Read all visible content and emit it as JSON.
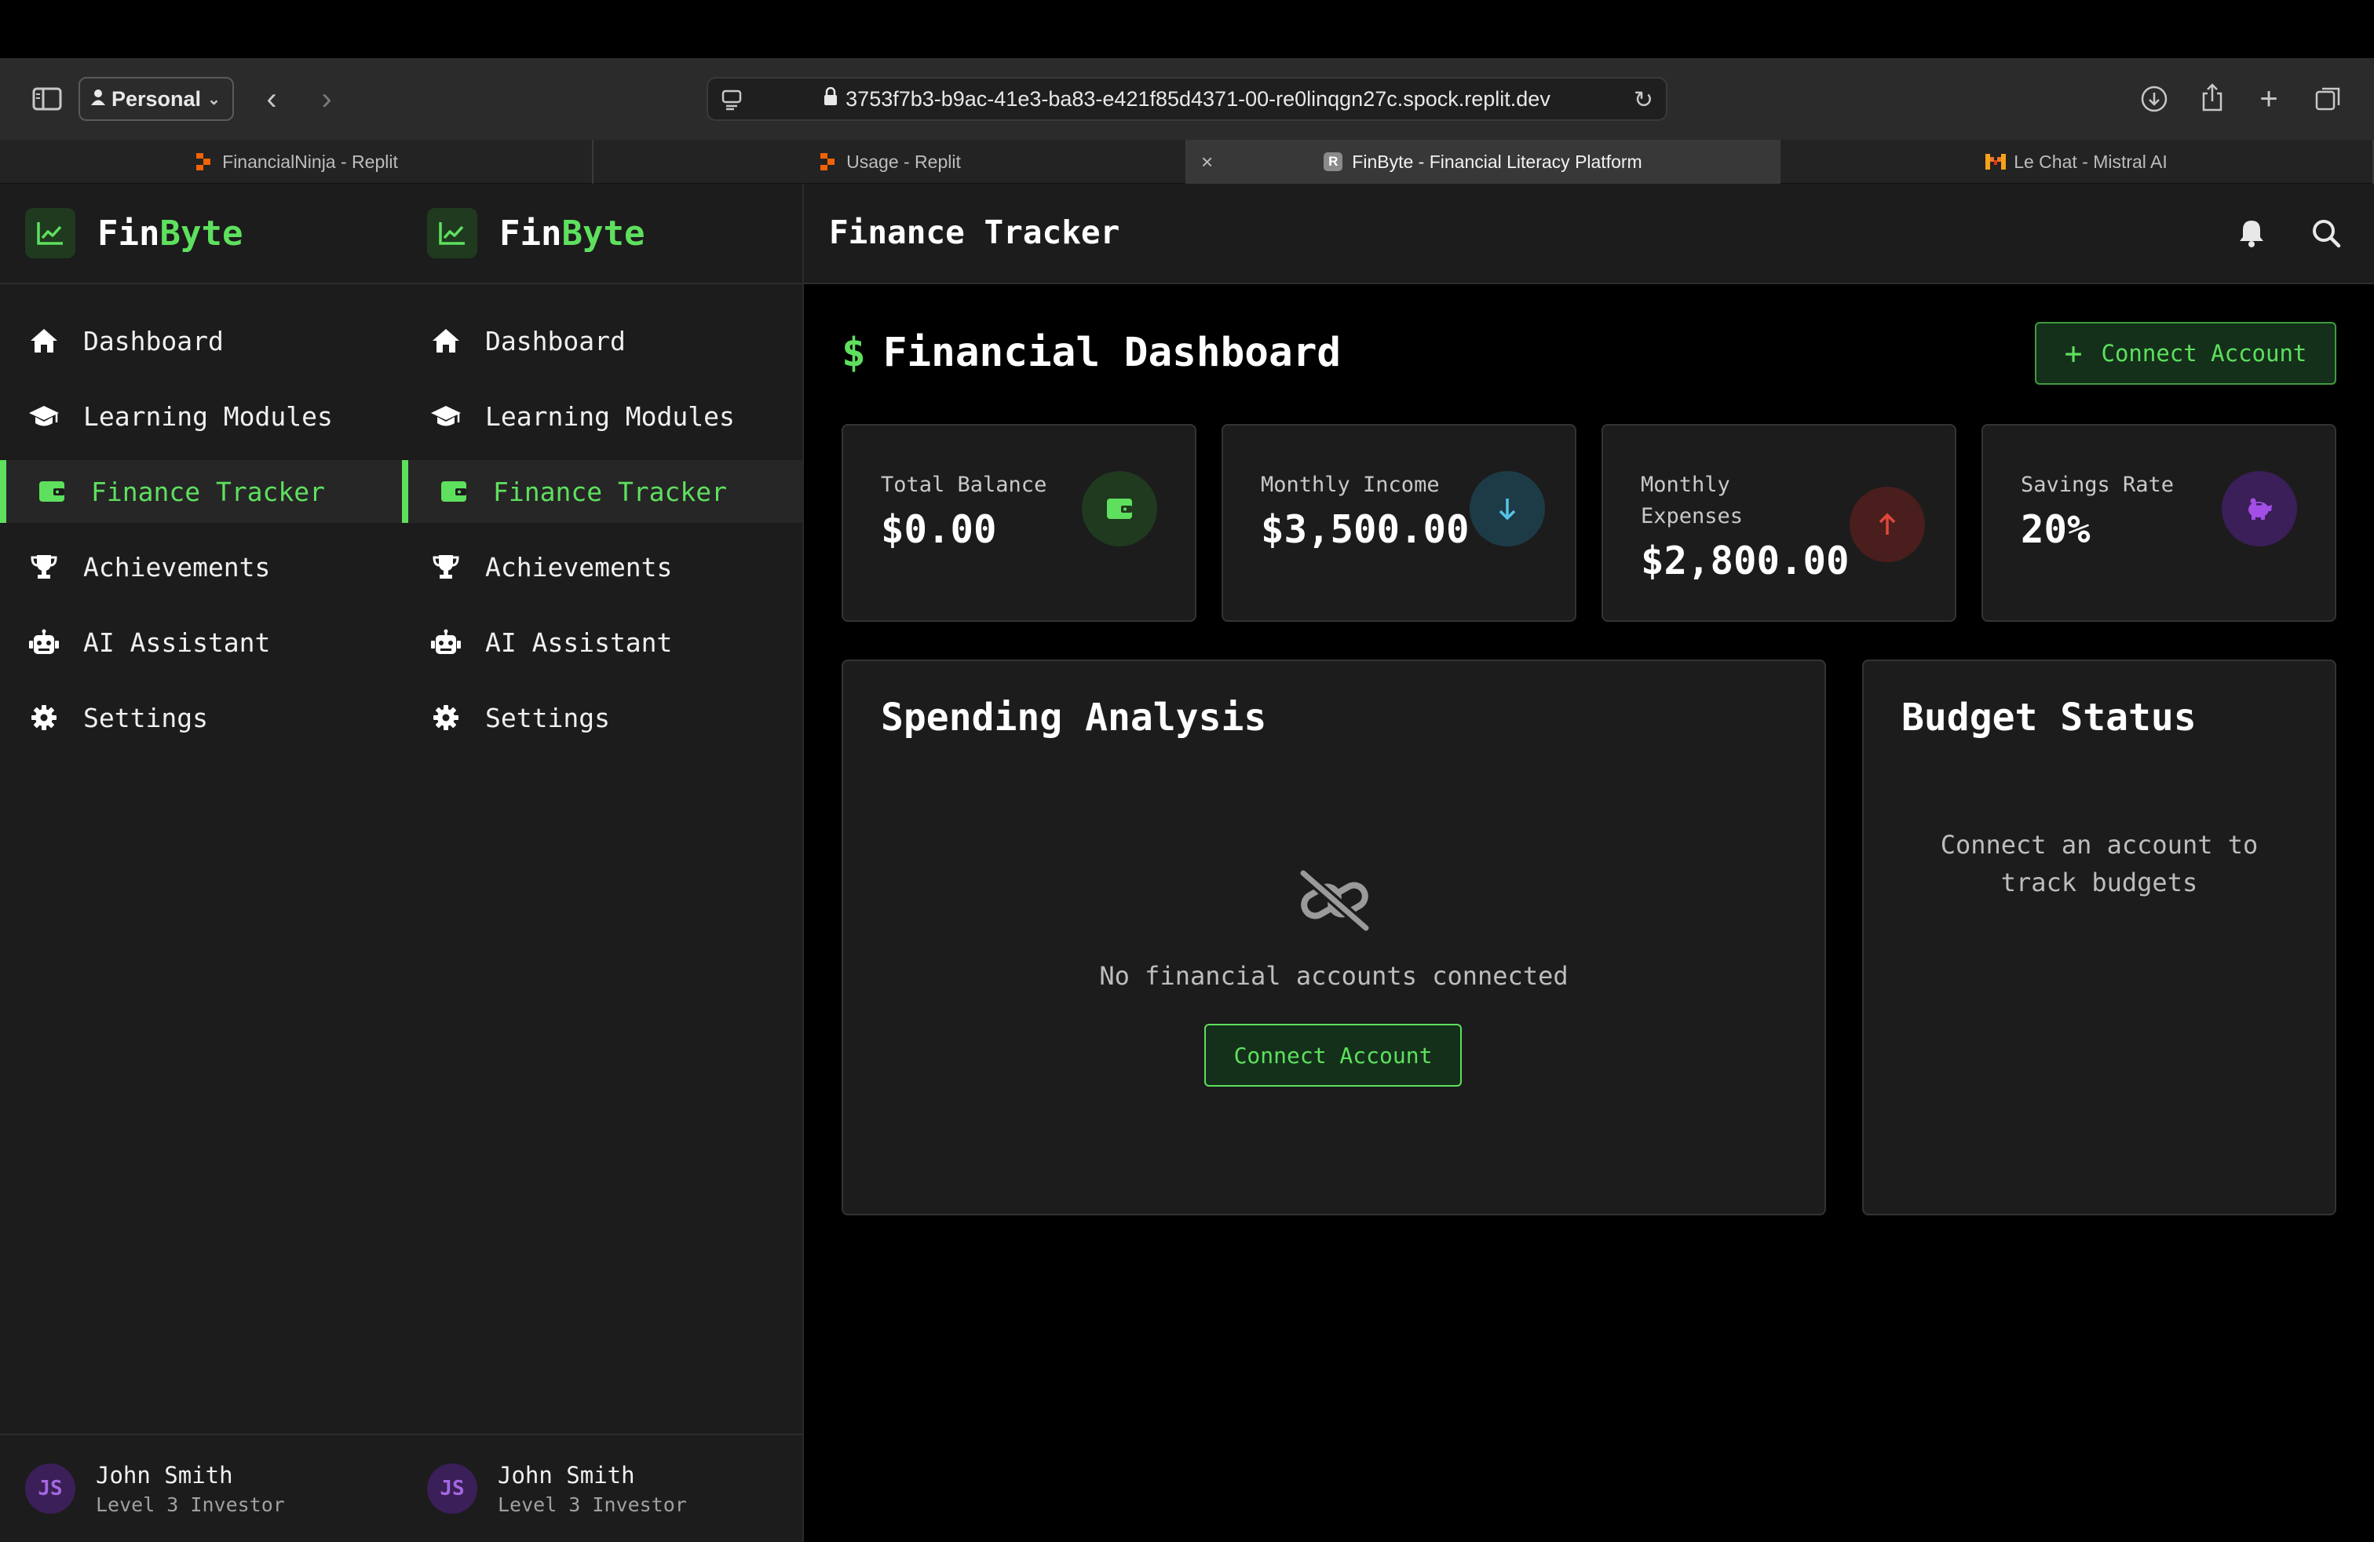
{
  "browser": {
    "profile": "Personal",
    "url": "3753f7b3-b9ac-41e3-ba83-e421f85d4371-00-re0linqgn27c.spock.replit.dev",
    "tabs": [
      {
        "title": "FinancialNinja - Replit",
        "favicon": "replit-icon"
      },
      {
        "title": "Usage - Replit",
        "favicon": "replit-icon"
      },
      {
        "title": "FinByte - Financial Literacy Platform",
        "favicon": "r-icon",
        "active": true
      },
      {
        "title": "Le Chat - Mistral AI",
        "favicon": "mistral-icon"
      }
    ]
  },
  "app": {
    "logo_prefix": "Fin",
    "logo_suffix": "Byte",
    "accent": "#5ee05e",
    "nav": [
      {
        "label": "Dashboard",
        "icon": "home-icon"
      },
      {
        "label": "Learning Modules",
        "icon": "graduation-cap-icon"
      },
      {
        "label": "Finance Tracker",
        "icon": "wallet-icon",
        "active": true
      },
      {
        "label": "Achievements",
        "icon": "trophy-icon"
      },
      {
        "label": "AI Assistant",
        "icon": "robot-icon"
      },
      {
        "label": "Settings",
        "icon": "gear-icon"
      }
    ],
    "user": {
      "initials": "JS",
      "name": "John Smith",
      "level": "Level 3 Investor"
    },
    "header_title": "Finance Tracker"
  },
  "dashboard": {
    "title_symbol": "$",
    "title": "Financial Dashboard",
    "connect_button": "Connect Account",
    "stats": [
      {
        "label": "Total Balance",
        "value": "$0.00",
        "icon": "wallet-icon",
        "color": "#5ee05e"
      },
      {
        "label": "Monthly Income",
        "value": "$3,500.00",
        "icon": "arrow-down-icon",
        "color": "#56c4e6"
      },
      {
        "label": "Monthly Expenses",
        "value": "$2,800.00",
        "icon": "arrow-up-icon",
        "color": "#e0483c"
      },
      {
        "label": "Savings Rate",
        "value": "20%",
        "icon": "piggy-bank-icon",
        "color": "#a34ee6"
      }
    ],
    "spending": {
      "title": "Spending Analysis",
      "empty_text": "No financial accounts connected",
      "button": "Connect Account"
    },
    "budget": {
      "title": "Budget Status",
      "empty_text_line1": "Connect an account to",
      "empty_text_line2": "track budgets"
    }
  }
}
